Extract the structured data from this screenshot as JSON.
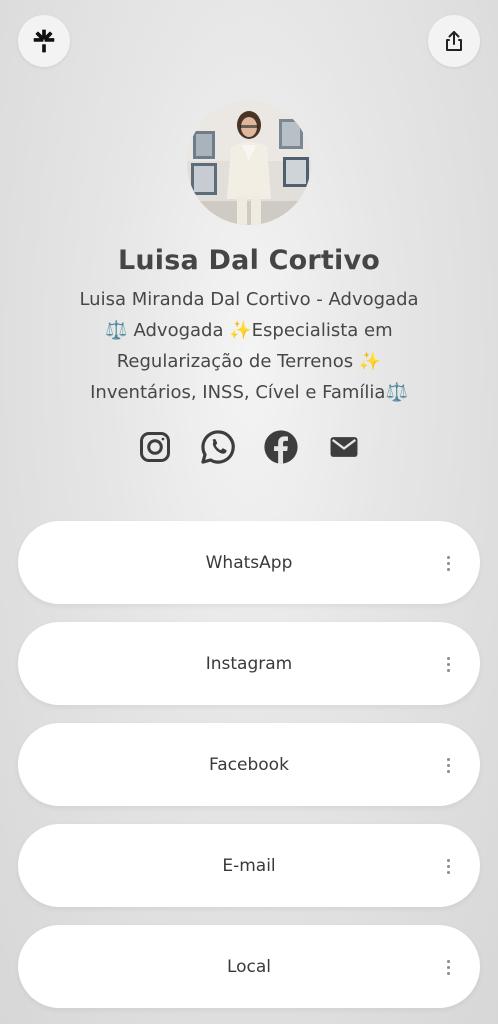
{
  "profile": {
    "name": "Luisa Dal Cortivo",
    "bio_lines": [
      "Luisa Miranda Dal Cortivo - Advogada",
      "⚖️ Advogada ✨Especialista em",
      "Regularização de Terrenos ✨",
      "Inventários, INSS, Cível e Família⚖️"
    ]
  },
  "top_bar": {
    "left_icon": "linktree-asterisk-icon",
    "right_icon": "share-icon"
  },
  "social_icons": [
    "instagram-icon",
    "whatsapp-icon",
    "facebook-icon",
    "email-icon"
  ],
  "links": [
    {
      "label": "WhatsApp"
    },
    {
      "label": "Instagram"
    },
    {
      "label": "Facebook"
    },
    {
      "label": "E-mail"
    },
    {
      "label": "Local"
    }
  ],
  "colors": {
    "icon": "#3d3d3d",
    "card": "#ffffff",
    "text": "#3a3a3a"
  }
}
